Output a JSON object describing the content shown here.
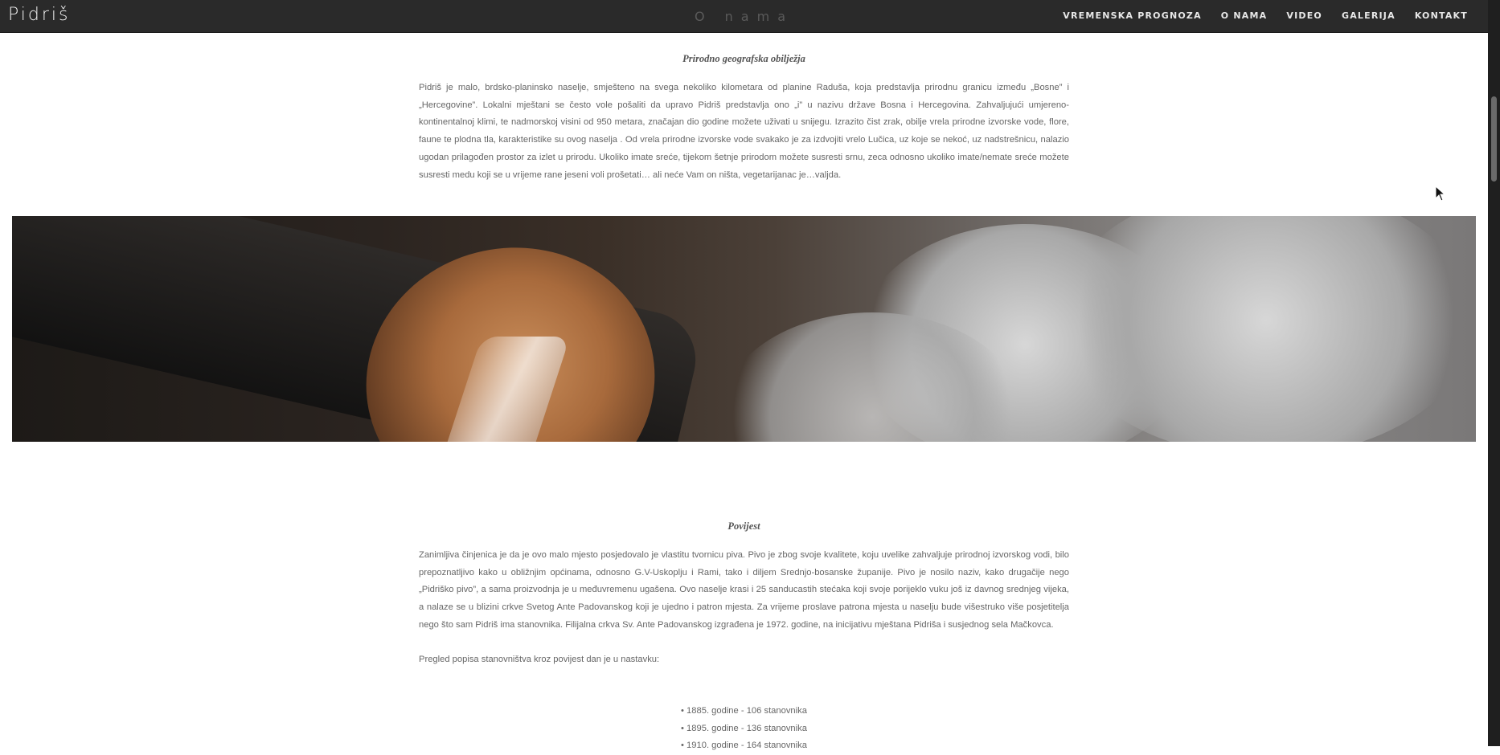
{
  "header": {
    "brand": "Pidriš",
    "page_title": "O nama",
    "nav": [
      "VREMENSKA PROGNOZA",
      "O NAMA",
      "VIDEO",
      "GALERIJA",
      "KONTAKT"
    ]
  },
  "sections": [
    {
      "heading": "Prirodno geografska obilježja",
      "text": "Pidriš je malo, brdsko-planinsko naselje, smješteno na svega nekoliko kilometara od planine Raduša, koja predstavlja prirodnu granicu između „Bosne” i „Hercegovine”. Lokalni mještani se često vole pošaliti da upravo Pidriš predstavlja ono „i” u nazivu države Bosna i Hercegovina. Zahvaljujući umjereno-kontinentalnoj klimi, te nadmorskoj visini od 950 metara, značajan dio godine možete uživati u snijegu. Izrazito čist zrak, obilje vrela prirodne izvorske vode, flore, faune te plodna tla, karakteristike su ovog naselja . Od vrela prirodne izvorske vode svakako je za izdvojiti vrelo Lučica, uz koje se nekoć, uz nadstrešnicu, nalazio ugodan prilagođen prostor za izlet u prirodu. Ukoliko imate sreće, tijekom šetnje prirodom možete susresti srnu, zeca odnosno ukoliko imate/nemate sreće možete susresti medu koji se u vrijeme rane jeseni voli prošetati… ali neće Vam on ništa, vegetarijanac je…valjda."
    },
    {
      "heading": "Povijest",
      "text": "Zanimljiva činjenica je da je ovo malo mjesto posjedovalo je vlastitu tvornicu piva. Pivo je zbog svoje kvalitete, koju uvelike zahvaljuje prirodnoj izvorskog vodi, bilo prepoznatljivo kako u obližnjim općinama, odnosno G.V-Uskoplju i Rami, tako i diljem Srednjo-bosanske županije. Pivo je nosilo naziv, kako drugačije nego „Pidriško pivo”, a sama proizvodnja je u međuvremenu ugašena. Ovo naselje krasi i 25 sanducastih stećaka koji svoje porijeklo vuku još iz davnog srednjeg vijeka, a nalaze se u blizini crkve Svetog Ante Padovanskog koji je ujedno i patron mjesta. Za vrijeme proslave patrona mjesta u naselju bude višestruko više posjetitelja nego što sam Pidriš ima stanovnika. Filijalna crkva Sv. Ante Padovanskog izgrađena je 1972. godine, na inicijativu mještana Pidriša i susjednog sela Mačkovca.",
      "census_intro": "Pregled popisa stanovništva kroz povijest dan je u nastavku:",
      "census": [
        "• 1885. godine - 106 stanovnika",
        "• 1895. godine - 136 stanovnika",
        "• 1910. godine - 164 stanovnika"
      ]
    }
  ]
}
